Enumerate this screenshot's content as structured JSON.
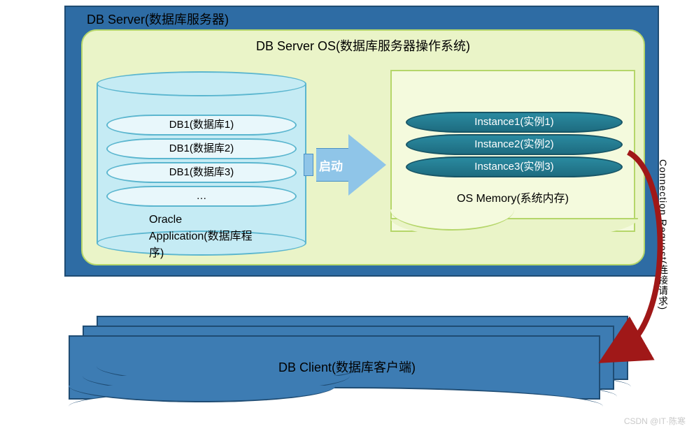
{
  "db_server": {
    "label": "DB Server(数据库服务器)"
  },
  "db_server_os": {
    "label": "DB Server OS(数据库服务器操作系统)"
  },
  "cylinder": {
    "rows": [
      {
        "label": "DB1(数据库1)"
      },
      {
        "label": "DB1(数据库2)"
      },
      {
        "label": "DB1(数据库3)"
      },
      {
        "label": "…"
      }
    ],
    "caption": "Oracle Application(数据库程序)"
  },
  "arrow": {
    "label": "启动"
  },
  "os_memory": {
    "instances": [
      {
        "label": "Instance1(实例1)"
      },
      {
        "label": "Instance2(实例2)"
      },
      {
        "label": "Instance3(实例3)"
      }
    ],
    "caption": "OS Memory(系统内存)"
  },
  "connection_request": {
    "label": "Connection Request(连接请求)"
  },
  "client": {
    "label": "DB Client(数据库客户端)"
  },
  "watermark": "CSDN @IT·陈寒"
}
